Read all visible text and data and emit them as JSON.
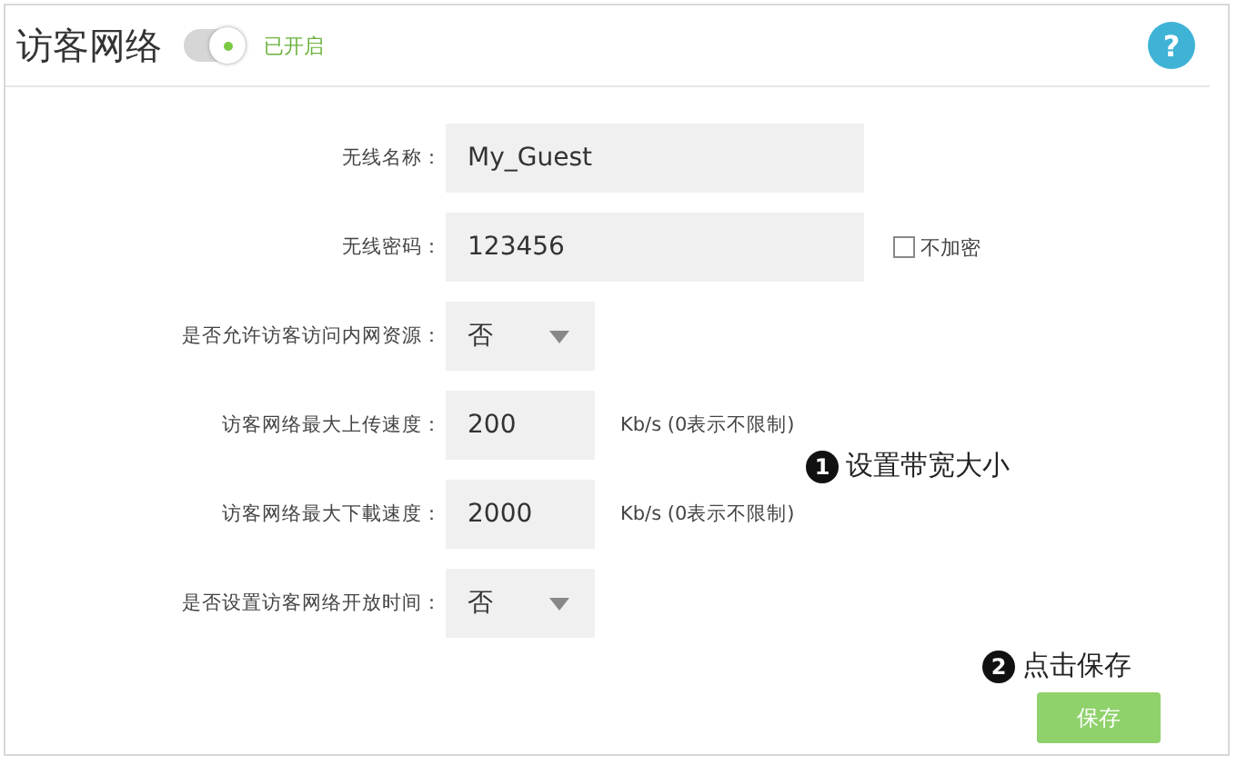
{
  "header": {
    "title": "访客网络",
    "toggle": {
      "on": true
    },
    "status": "已开启",
    "help": "?"
  },
  "rows": [
    {
      "kind": "text",
      "label": "无线名称：",
      "value": "My_Guest"
    },
    {
      "kind": "text",
      "label": "无线密码：",
      "value": "123456",
      "checkbox": {
        "label": "不加密",
        "checked": false
      }
    },
    {
      "kind": "select",
      "label": "是否允许访客访问内网资源：",
      "value": "否"
    },
    {
      "kind": "text",
      "label": "访客网络最大上传速度：",
      "value": "200",
      "unit": "Kb/s (0表示不限制)"
    },
    {
      "kind": "text",
      "label": "访客网络最大下載速度：",
      "value": "2000",
      "unit": "Kb/s (0表示不限制)"
    },
    {
      "kind": "select",
      "label": "是否设置访客网络开放时间：",
      "value": "否"
    }
  ],
  "annotations": [
    {
      "number": "1",
      "text": "设置带宽大小"
    },
    {
      "number": "2",
      "text": "点击保存"
    }
  ],
  "save_button": "保存"
}
